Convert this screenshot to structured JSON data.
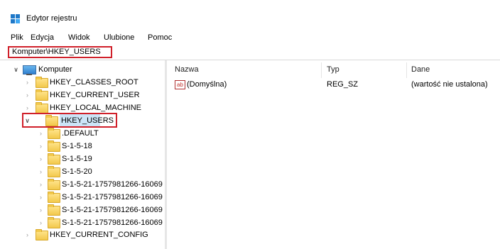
{
  "window": {
    "title": "Edytor rejestru",
    "icon": "regedit-icon"
  },
  "menu": [
    "Plik",
    "Edycja",
    "Widok",
    "Ulubione",
    "Pomoc"
  ],
  "address": "Komputer\\HKEY_USERS",
  "tree": {
    "root": "Komputer",
    "hives": [
      "HKEY_CLASSES_ROOT",
      "HKEY_CURRENT_USER",
      "HKEY_LOCAL_MACHINE",
      "HKEY_USERS"
    ],
    "users_children": [
      ".DEFAULT",
      "S-1-5-18",
      "S-1-5-19",
      "S-1-5-20",
      "S-1-5-21-1757981266-16069",
      "S-1-5-21-1757981266-16069",
      "S-1-5-21-1757981266-16069",
      "S-1-5-21-1757981266-16069"
    ],
    "last": "HKEY_CURRENT_CONFIG",
    "selected": "HKEY_USERS"
  },
  "list": {
    "columns": [
      "Nazwa",
      "Typ",
      "Dane"
    ],
    "rows": [
      {
        "name": "(Domyślna)",
        "type": "REG_SZ",
        "data": "(wartość nie ustalona)"
      }
    ]
  },
  "colors": {
    "highlight_border": "#d0202a",
    "selection": "#cce4f7",
    "folder": "#f2c94c"
  }
}
